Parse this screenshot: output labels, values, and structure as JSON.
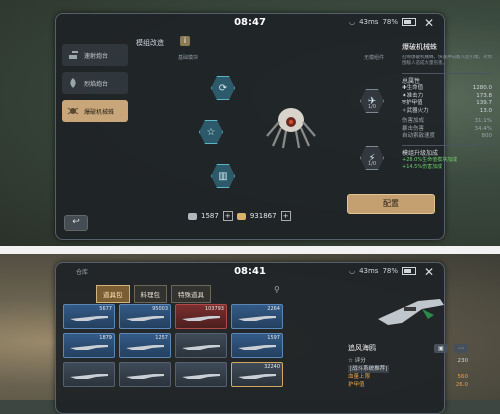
{
  "top": {
    "time": "08:47",
    "status": {
      "signal": "43ms",
      "battery": "78%"
    },
    "nav": [
      {
        "label": "速射炮台",
        "icon": "turret-icon"
      },
      {
        "label": "烈焰炮台",
        "icon": "flame-icon"
      },
      {
        "label": "爆破机械蛛",
        "icon": "spider-icon"
      }
    ],
    "nav_active_index": 2,
    "mod_title": "模组改造",
    "mod_info_glyph": "i",
    "slot_left_label": "基础模块",
    "slot_right_label": "无模组件",
    "hex_right": [
      {
        "sub": "1/0"
      },
      {
        "sub": "1/0"
      }
    ],
    "currency": [
      {
        "value": "1587"
      },
      {
        "value": "931867"
      }
    ],
    "detail": {
      "title": "爆破机械蛛",
      "desc": "召唤爆破机械蛛，快速冲向敌人后引爆，对周围敌人造成大量伤害。",
      "section_total": "总属性",
      "stats": [
        {
          "label": "生命值",
          "value": "1280.0"
        },
        {
          "label": "准击力",
          "value": "173.8"
        },
        {
          "label": "护甲值",
          "value": "139.7"
        },
        {
          "label": "武器火力",
          "value": "13.0"
        }
      ],
      "stats2": [
        {
          "label": "伤害加成",
          "value": "31.1%"
        },
        {
          "label": "暴击伤害",
          "value": "34.4%"
        },
        {
          "label": "自动索敌速度",
          "value": "800"
        }
      ],
      "section_upgrade": "模组升级加成",
      "upgrades": [
        "+28.0%生命值模块加成",
        "+14.5%伤害加成"
      ],
      "config_label": "配置"
    }
  },
  "bottom": {
    "time": "08:41",
    "status": {
      "signal": "43ms",
      "battery": "78%"
    },
    "corner_label": "仓库",
    "tabs": [
      "道具包",
      "料理包",
      "特殊道具"
    ],
    "active_tab": 0,
    "cells": [
      {
        "count": "5677",
        "tone": "blue"
      },
      {
        "count": "95003",
        "tone": "blue"
      },
      {
        "count": "103793",
        "tone": "red"
      },
      {
        "count": "2264",
        "tone": "blue"
      },
      {
        "count": "1879",
        "tone": "blue"
      },
      {
        "count": "1257",
        "tone": "blue"
      },
      {
        "count": "",
        "tone": "gray"
      },
      {
        "count": "1597",
        "tone": "blue"
      },
      {
        "count": "",
        "tone": "gray"
      },
      {
        "count": "",
        "tone": "gray"
      },
      {
        "count": "",
        "tone": "gray"
      },
      {
        "count": "32240",
        "tone": "gold"
      }
    ],
    "item": {
      "name": "追风海鸥",
      "rating_label": "评分",
      "rating_value": "230",
      "tag": "[战斗系统推荐]",
      "rows": [
        {
          "label": "血量上限",
          "value": "560"
        },
        {
          "label": "护甲值",
          "value": "26.0"
        }
      ]
    }
  }
}
